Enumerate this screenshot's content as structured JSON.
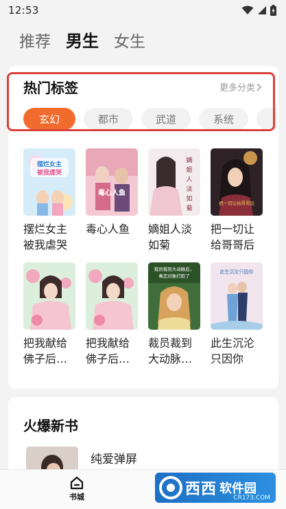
{
  "status_bar": {
    "time": "12:53",
    "icons": [
      "wifi-icon",
      "signal-icon",
      "battery-icon"
    ]
  },
  "top_tabs": [
    {
      "label": "推荐",
      "active": false
    },
    {
      "label": "男生",
      "active": true
    },
    {
      "label": "女生",
      "active": false
    }
  ],
  "hot_tags": {
    "title": "热门标签",
    "more_label": "更多分类",
    "tags": [
      {
        "label": "玄幻",
        "active": true
      },
      {
        "label": "都市",
        "active": false
      },
      {
        "label": "武道",
        "active": false
      },
      {
        "label": "系统",
        "active": false
      }
    ],
    "books": [
      {
        "title": "摆烂女主被我虐哭",
        "cover_text": "摆烂女主被我虐哭",
        "cover_color": "#cfe6f5"
      },
      {
        "title": "毒心人鱼",
        "cover_text": "毒心人鱼",
        "cover_color": "#f3c7d0"
      },
      {
        "title": "嫡姐人淡如菊",
        "cover_text": "嫡姐人淡如菊",
        "cover_color": "#efe7ea"
      },
      {
        "title": "把一切让给哥哥后",
        "cover_text": "把一切让给哥哥后",
        "cover_color": "#3a2a2e"
      },
      {
        "title": "把我献给佛子后…",
        "cover_text": "",
        "cover_color": "#d8ecd8"
      },
      {
        "title": "把我献给佛子后…",
        "cover_text": "",
        "cover_color": "#d8ecd8"
      },
      {
        "title": "裁员裁到大动脉…",
        "cover_text": "裁员裁到大动脉后，毒恋对象打脸了",
        "cover_color": "#3c6b3a"
      },
      {
        "title": "此生沉沦只因你",
        "cover_text": "此生沉沦只因你",
        "cover_color": "#f1e3ec"
      }
    ]
  },
  "new_books": {
    "title": "火爆新书",
    "items": [
      {
        "title": "纯爱弹屏"
      }
    ]
  },
  "bottom_nav": {
    "home_label": "书城"
  },
  "watermark": {
    "text": "西西",
    "sub": "软件园",
    "url": "CR173.COM"
  },
  "colors": {
    "accent": "#f26b2e",
    "highlight": "#d9403a",
    "background": "#f3f3f3"
  }
}
